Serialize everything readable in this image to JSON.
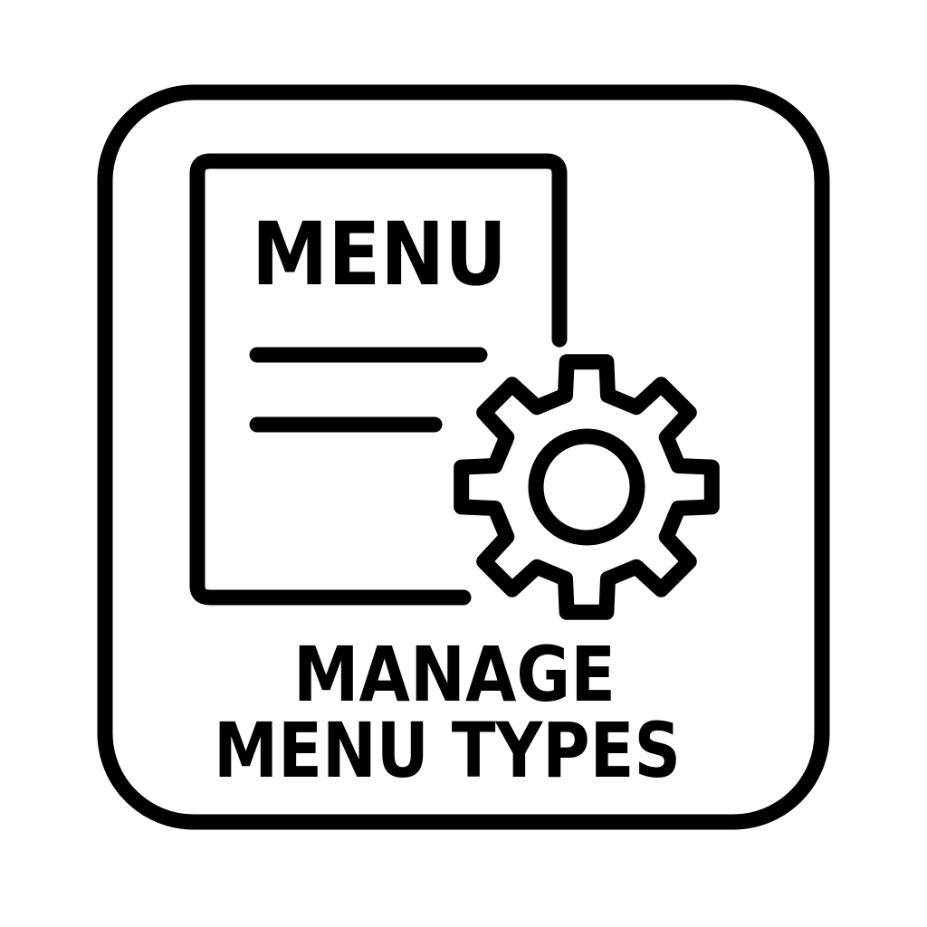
{
  "icon": {
    "name": "menu-settings-icon",
    "document_heading": "MENU",
    "gear": "gear-icon"
  },
  "caption": {
    "line1": "MANAGE",
    "line2": "MENU TYPES"
  },
  "colors": {
    "ink": "#000000",
    "background": "#ffffff"
  }
}
